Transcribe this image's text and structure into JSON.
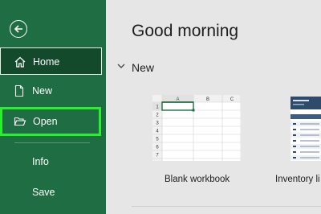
{
  "sidebar": {
    "items": [
      {
        "label": "Home",
        "icon": "home-icon"
      },
      {
        "label": "New",
        "icon": "new-document-icon"
      },
      {
        "label": "Open",
        "icon": "folder-open-icon"
      },
      {
        "label": "Info"
      },
      {
        "label": "Save"
      }
    ]
  },
  "main": {
    "greeting": "Good morning",
    "section_title": "New",
    "templates": [
      {
        "label": "Blank workbook"
      },
      {
        "label": "Inventory li"
      }
    ],
    "blank_grid": {
      "columns": [
        "A",
        "B",
        "C"
      ],
      "rows": [
        "1",
        "2",
        "3",
        "4",
        "5",
        "6",
        "7"
      ]
    }
  },
  "colors": {
    "sidebar": "#1f6e43",
    "home_selected": "#134a2c",
    "highlight": "#28f02a",
    "inventory_header": "#2f4b6b"
  }
}
